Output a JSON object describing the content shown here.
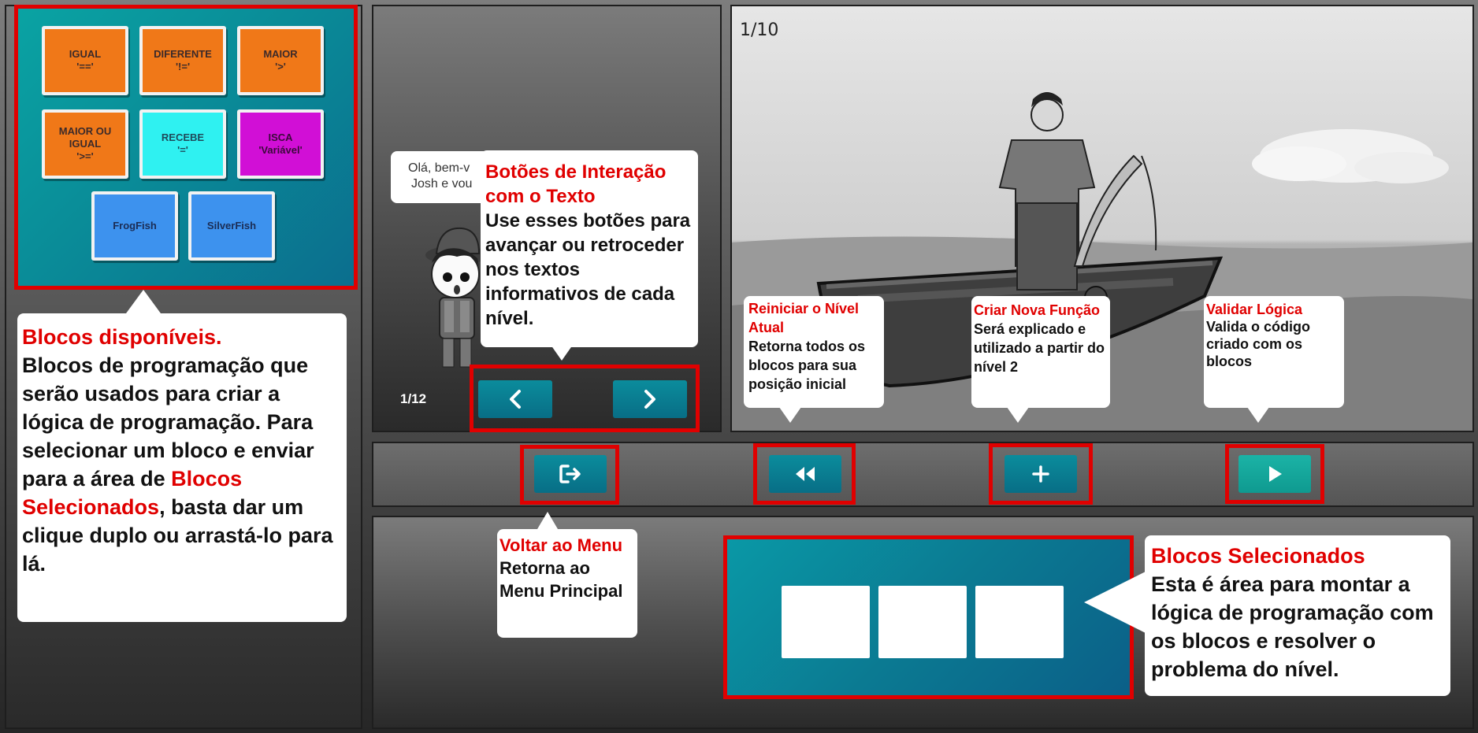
{
  "blocks_panel": {
    "blocks": [
      {
        "label": "IGUAL\n'=='",
        "color": "orange"
      },
      {
        "label": "DIFERENTE\n'!='",
        "color": "orange"
      },
      {
        "label": "MAIOR\n'>'",
        "color": "orange"
      },
      {
        "label": "MAIOR OU\nIGUAL\n'>='",
        "color": "orange"
      },
      {
        "label": "RECEBE\n'='",
        "color": "cyan"
      },
      {
        "label": "ISCA\n'Variável'",
        "color": "purple"
      },
      {
        "label": "FrogFish",
        "color": "blue"
      },
      {
        "label": "SilverFish",
        "color": "blue"
      }
    ]
  },
  "tips": {
    "blocks_available": {
      "title": "Blocos disponíveis.",
      "body_1": "Blocos de programação que serão usados para criar a lógica de programação. Para selecionar um bloco e enviar para a área de ",
      "highlight": "Blocos Selecionados",
      "body_2": ", basta dar um clique duplo ou arrastá-lo para lá."
    },
    "text_buttons": {
      "title": "Botões de Interação com o Texto",
      "body": "Use esses botões para avançar ou retroceder nos textos informativos de cada nível."
    },
    "reset": {
      "title": "Reiniciar o Nível Atual",
      "body": "Retorna todos os blocos para sua posição inicial"
    },
    "new_function": {
      "title": "Criar Nova Função",
      "body": "Será explicado e utilizado a partir do nível 2"
    },
    "validate": {
      "title": "Validar Lógica",
      "body": "Valida o código criado com os blocos"
    },
    "back_menu": {
      "title": "Voltar ao Menu",
      "body": "Retorna ao Menu Principal"
    },
    "selected_blocks": {
      "title": "Blocos Selecionados",
      "body": "Esta é área para montar a lógica de programação com os blocos e resolver o problema do nível."
    }
  },
  "dialog": {
    "speech_line1": "Olá, bem-v",
    "speech_line2": "Josh e vou",
    "page_counter": "1/12"
  },
  "scene": {
    "counter": "1/10"
  },
  "colors": {
    "highlight_red": "#e00000",
    "teal": "#0a8c98",
    "orange_block": "#f07818",
    "cyan_block": "#2ff1f1",
    "purple_block": "#d10fd6",
    "blue_block": "#3d92ee",
    "validate_green": "#1bb3a6"
  },
  "icons": [
    "chevron-left-icon",
    "chevron-right-icon",
    "exit-icon",
    "rewind-icon",
    "plus-icon",
    "play-icon"
  ]
}
